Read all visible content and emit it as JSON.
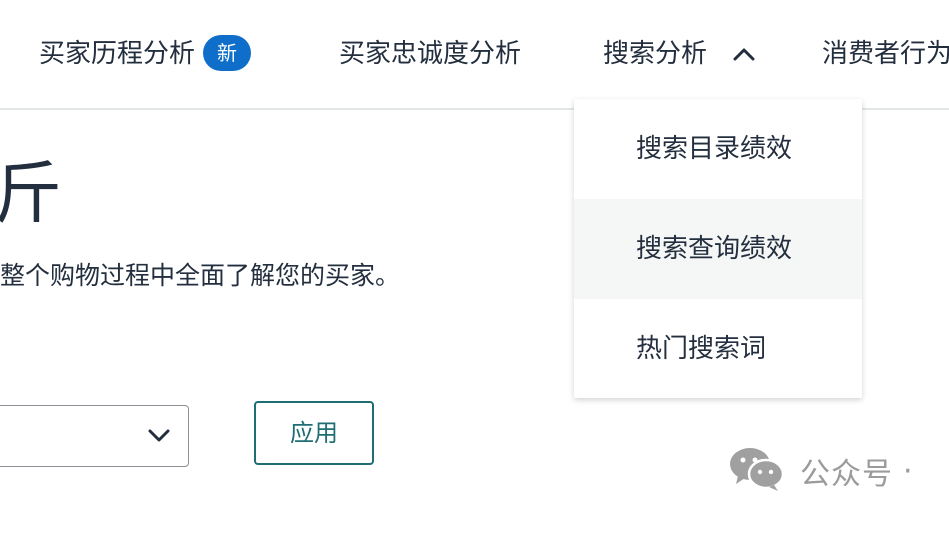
{
  "nav": {
    "items": [
      {
        "label": "买家历程分析",
        "badge": "新"
      },
      {
        "label": "买家忠诚度分析"
      },
      {
        "label": "搜索分析",
        "expanded": true
      },
      {
        "label": "消费者行为"
      }
    ]
  },
  "dropdown": {
    "items": [
      {
        "label": "搜索目录绩效"
      },
      {
        "label": "搜索查询绩效",
        "hovered": true
      },
      {
        "label": "热门搜索词"
      }
    ]
  },
  "page": {
    "title_fragment": "斤",
    "subtitle": "整个购物过程中全面了解您的买家。"
  },
  "filters": {
    "select_value": "",
    "apply_label": "应用"
  },
  "watermark": {
    "text": "公众号",
    "icon": "wechat-icon"
  },
  "colors": {
    "badge": "#0f6ec9",
    "apply_border": "#1f6e74",
    "text": "#232f3e",
    "watermark": "#9b9b9b"
  }
}
